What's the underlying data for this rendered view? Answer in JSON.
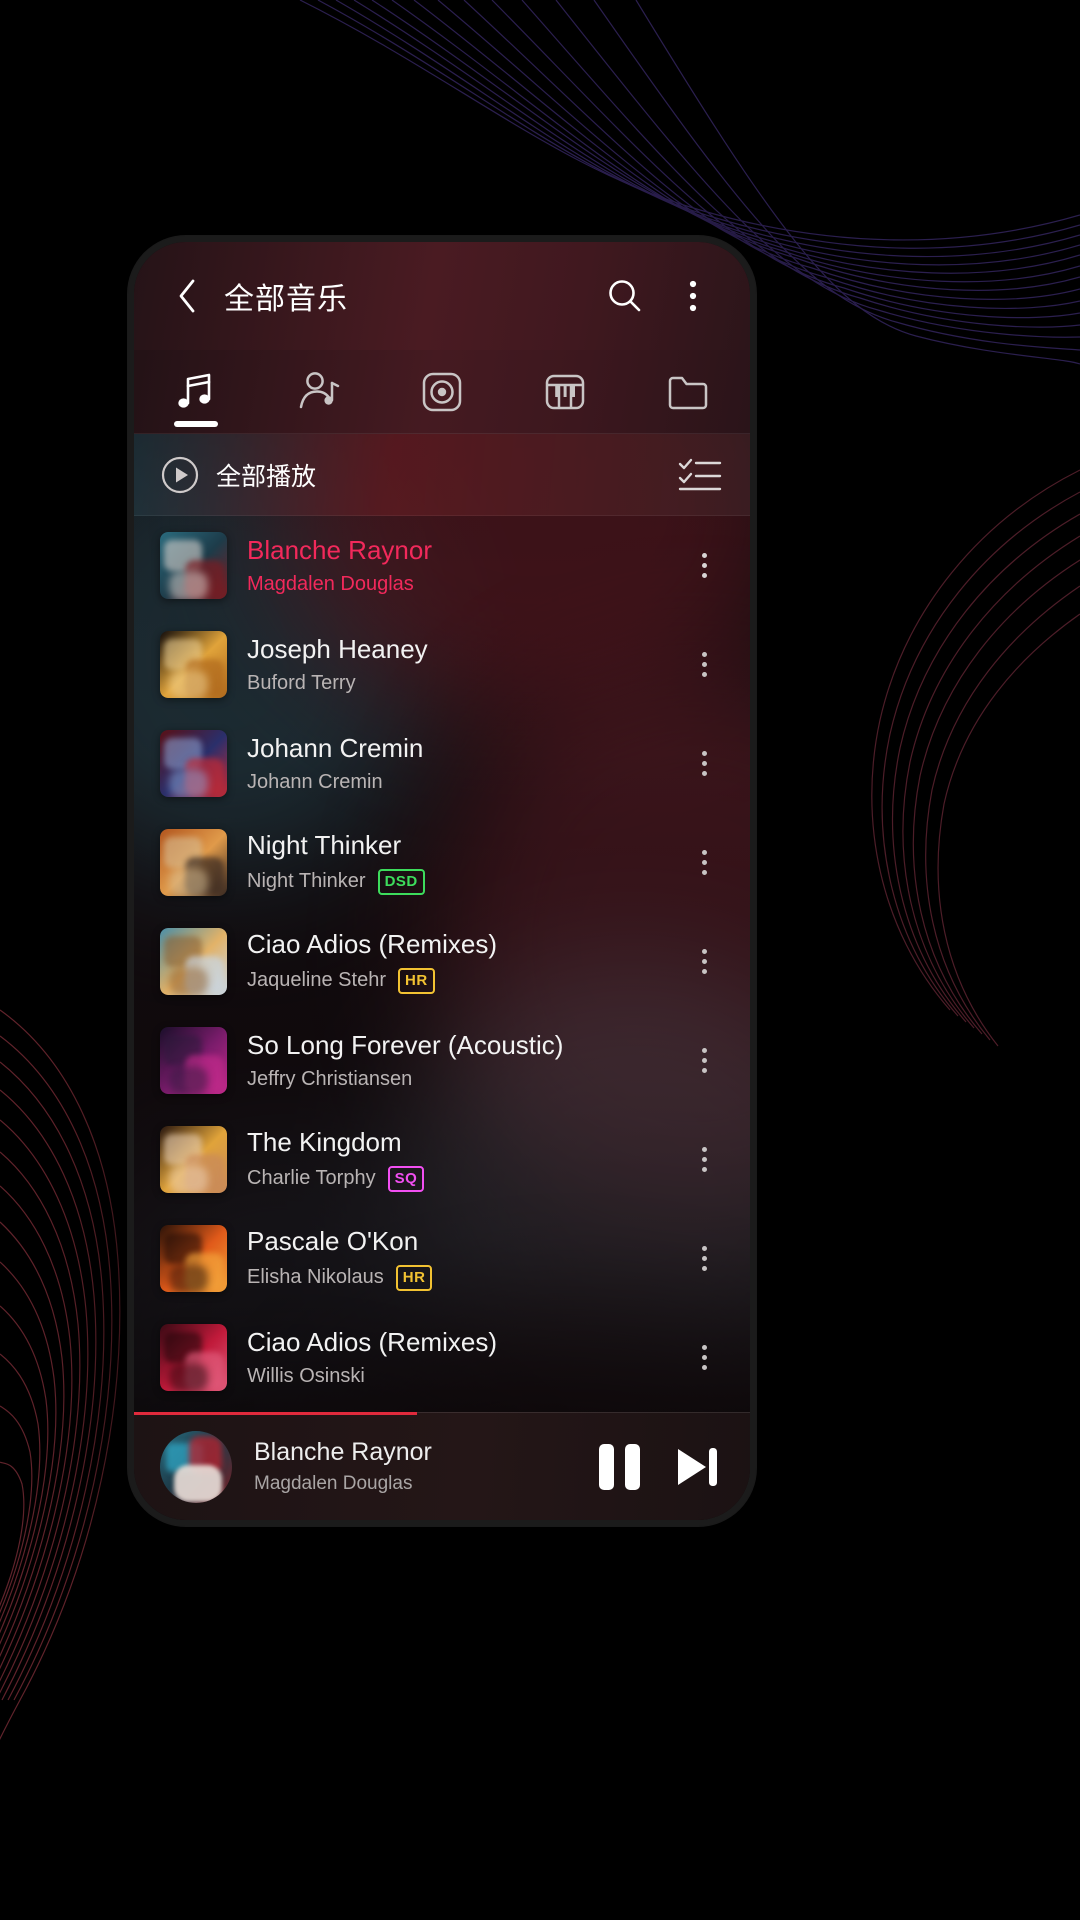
{
  "app": {
    "header": {
      "title": "全部音乐",
      "back_icon": "chevron-left-icon",
      "search_icon": "search-icon",
      "overflow_icon": "more-vertical-icon"
    },
    "tabs": [
      {
        "name": "songs",
        "icon": "music-note-icon",
        "active": true
      },
      {
        "name": "artists",
        "icon": "artist-icon",
        "active": false
      },
      {
        "name": "albums",
        "icon": "album-disc-icon",
        "active": false
      },
      {
        "name": "genres",
        "icon": "piano-icon",
        "active": false
      },
      {
        "name": "folders",
        "icon": "folder-icon",
        "active": false
      }
    ],
    "play_all": {
      "label": "全部播放",
      "play_icon": "play-circle-icon",
      "multiselect_icon": "checklist-icon"
    },
    "songs": [
      {
        "title": "Blanche Raynor",
        "artist": "Magdalen Douglas",
        "badge": "",
        "playing": true
      },
      {
        "title": "Joseph Heaney",
        "artist": "Buford Terry",
        "badge": "",
        "playing": false
      },
      {
        "title": "Johann Cremin",
        "artist": "Johann Cremin",
        "badge": "",
        "playing": false
      },
      {
        "title": "Night Thinker",
        "artist": "Night Thinker",
        "badge": "DSD",
        "playing": false
      },
      {
        "title": "Ciao Adios (Remixes)",
        "artist": "Jaqueline Stehr",
        "badge": "HR",
        "playing": false
      },
      {
        "title": "So Long Forever (Acoustic)",
        "artist": "Jeffry Christiansen",
        "badge": "",
        "playing": false
      },
      {
        "title": "The Kingdom",
        "artist": "Charlie Torphy",
        "badge": "SQ",
        "playing": false
      },
      {
        "title": "Pascale O'Kon",
        "artist": "Elisha Nikolaus",
        "badge": "HR",
        "playing": false
      },
      {
        "title": "Ciao Adios (Remixes)",
        "artist": "Willis Osinski",
        "badge": "",
        "playing": false
      }
    ],
    "row_more_icon": "more-vertical-icon",
    "player": {
      "title": "Blanche Raynor",
      "artist": "Magdalen Douglas",
      "pause_icon": "pause-icon",
      "next_icon": "skip-next-icon",
      "progress_percent": 46
    },
    "colors": {
      "accent_playing": "#f2295b",
      "badge_dsd": "#3ddc5c",
      "badge_hr": "#f2c232",
      "badge_sq": "#f24ff2",
      "progress": "#e02a3c"
    }
  }
}
